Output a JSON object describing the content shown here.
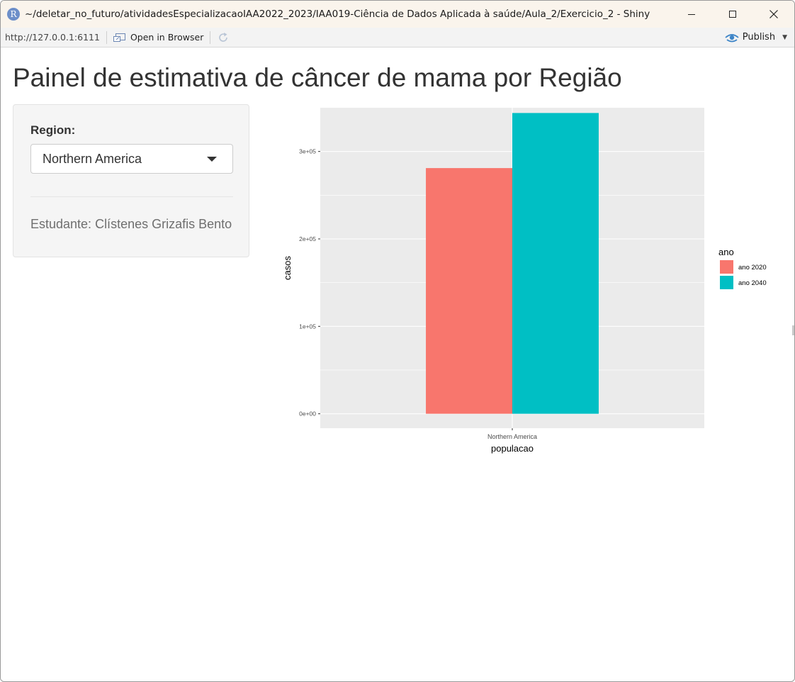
{
  "window": {
    "title": "~/deletar_no_futuro/atividadesEspecializacaoIAA2022_2023/IAA019-Ciência de Dados Aplicada à saúde/Aula_2/Exercicio_2 - Shiny",
    "app_icon_letter": "R"
  },
  "toolbar": {
    "url": "http://127.0.0.1:6111",
    "open_in_browser_label": "Open in Browser",
    "publish_label": "Publish"
  },
  "page": {
    "title": "Painel de estimativa de câncer de mama por Região"
  },
  "sidebar": {
    "region_label": "Region:",
    "region_selected": "Northern America",
    "student_text": "Estudante: Clístenes Grizafis Bento"
  },
  "chart_data": {
    "type": "bar",
    "categories": [
      "Northern America"
    ],
    "series": [
      {
        "name": "ano 2020",
        "values": [
          281000
        ],
        "color": "#F8766D"
      },
      {
        "name": "ano 2040",
        "values": [
          344000
        ],
        "color": "#00BFC4"
      }
    ],
    "xlabel": "populacao",
    "ylabel": "casos",
    "ylim": [
      -16500,
      350000
    ],
    "yticks": [
      0,
      100000,
      200000,
      300000
    ],
    "ytick_labels": [
      "0e+00",
      "1e+05",
      "2e+05",
      "3e+05"
    ],
    "legend_title": "ano",
    "legend_position": "right",
    "grid": true,
    "panel_background": "#EBEBEB"
  }
}
